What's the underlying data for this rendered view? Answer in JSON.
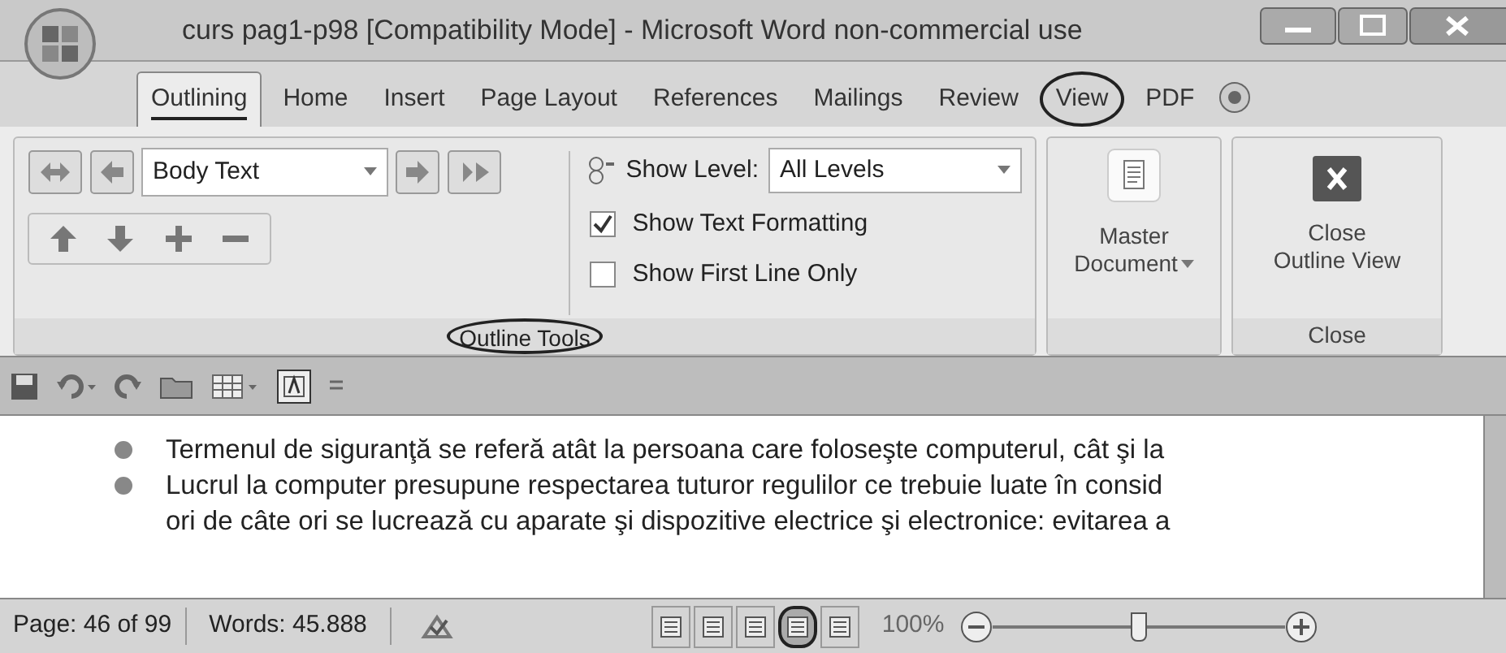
{
  "window": {
    "title": "curs pag1-p98 [Compatibility Mode] - Microsoft Word non-commercial use"
  },
  "tabs": [
    {
      "label": "Outlining",
      "selected": true,
      "underlined": true,
      "circled": false
    },
    {
      "label": "Home",
      "selected": false,
      "underlined": false,
      "circled": false
    },
    {
      "label": "Insert",
      "selected": false,
      "underlined": false,
      "circled": false
    },
    {
      "label": "Page Layout",
      "selected": false,
      "underlined": false,
      "circled": false
    },
    {
      "label": "References",
      "selected": false,
      "underlined": false,
      "circled": false
    },
    {
      "label": "Mailings",
      "selected": false,
      "underlined": false,
      "circled": false
    },
    {
      "label": "Review",
      "selected": false,
      "underlined": false,
      "circled": false
    },
    {
      "label": "View",
      "selected": false,
      "underlined": false,
      "circled": true
    },
    {
      "label": "PDF",
      "selected": false,
      "underlined": false,
      "circled": false
    }
  ],
  "ribbon": {
    "outline_tools": {
      "level_dropdown": {
        "value": "Body Text"
      },
      "show_level": {
        "label": "Show Level:",
        "value": "All Levels"
      },
      "checkboxes": [
        {
          "label": "Show Text Formatting",
          "checked": true
        },
        {
          "label": "Show First Line Only",
          "checked": false
        }
      ],
      "group_label": "Outline Tools",
      "group_label_circled": true
    },
    "master_document": {
      "label_line_1": "Master",
      "label_line_2": "Document"
    },
    "close": {
      "label_line_1": "Close",
      "label_line_2": "Outline View",
      "group_label": "Close"
    }
  },
  "document": {
    "paragraphs": [
      {
        "lines": [
          "Termenul de siguranţă se referă atât la persoana care foloseşte computerul, cât şi la"
        ]
      },
      {
        "lines": [
          "Lucrul la computer presupune respectarea tuturor regulilor ce trebuie luate în consid",
          "ori de câte ori se lucrează cu aparate şi dispozitive electrice şi electronice: evitarea a"
        ]
      }
    ]
  },
  "status_bar": {
    "page": "Page: 46 of 99",
    "words": "Words: 45.888",
    "views": [
      {
        "selected": false,
        "circled": false
      },
      {
        "selected": false,
        "circled": false
      },
      {
        "selected": false,
        "circled": false
      },
      {
        "selected": true,
        "circled": true
      },
      {
        "selected": false,
        "circled": false
      }
    ],
    "zoom": "100%",
    "zoom_slider": {
      "level": 0.5
    }
  }
}
